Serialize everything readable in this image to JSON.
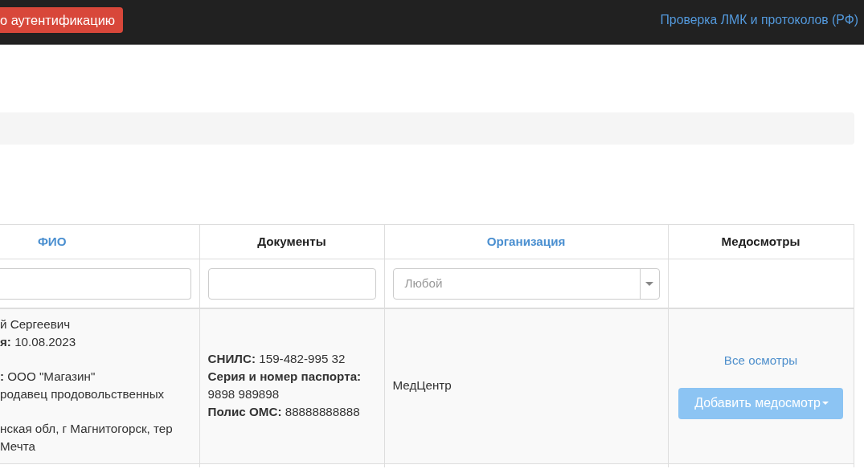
{
  "navbar": {
    "auth_button": "о аутентификацию",
    "link": "Проверка ЛМК и протоколов (РФ)"
  },
  "table": {
    "columns": [
      {
        "label": "ФИО",
        "sortable": true
      },
      {
        "label": "Документы",
        "sortable": false
      },
      {
        "label": "Организация",
        "sortable": true
      },
      {
        "label": "Медосмотры",
        "sortable": false
      }
    ],
    "filters": [
      {
        "kind": "text"
      },
      {
        "kind": "text"
      },
      {
        "kind": "select",
        "placeholder": "Любой"
      },
      {
        "kind": "none"
      }
    ],
    "rows": [
      {
        "person": [
          [
            "й Сергеевич",
            "**я:** 10.08.2023"
          ],
          [
            "**:** ООО \"Магазин\"",
            "родавец продовольственных"
          ],
          [
            "нская обл, г Магнитогорск, тер",
            "Мечта"
          ]
        ],
        "documents": [
          "**СНИЛС:** 159-482-995 32",
          "**Серия и номер паспорта:** 9898 989898",
          "**Полис ОМС:** 88888888888"
        ],
        "organization": "МедЦентр",
        "exams_link": "Все осмотры",
        "add_button": "Добавить медосмотр"
      }
    ]
  }
}
